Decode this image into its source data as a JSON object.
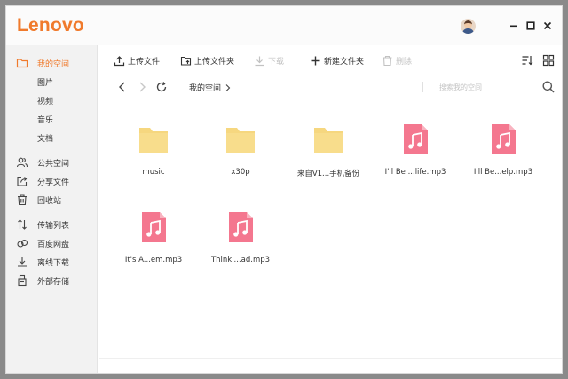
{
  "app": {
    "brand": "Lenovo",
    "accent_color": "#f07a2c"
  },
  "titlebar": {
    "avatar": "user-avatar",
    "minimize_icon": "minimize-icon",
    "maximize_icon": "maximize-icon",
    "close_icon": "close-icon"
  },
  "sidebar": {
    "my_space": {
      "label": "我的空间",
      "icon": "folder-icon"
    },
    "sub_items": [
      {
        "label": "图片"
      },
      {
        "label": "视频"
      },
      {
        "label": "音乐"
      },
      {
        "label": "文档"
      }
    ],
    "items": [
      {
        "label": "公共空间",
        "icon": "users-icon"
      },
      {
        "label": "分享文件",
        "icon": "share-icon"
      },
      {
        "label": "回收站",
        "icon": "trash-icon"
      },
      {
        "label": "传输列表",
        "icon": "transfer-icon"
      },
      {
        "label": "百度网盘",
        "icon": "cloud-icon"
      },
      {
        "label": "离线下载",
        "icon": "download-icon"
      },
      {
        "label": "外部存储",
        "icon": "usb-drive-icon"
      }
    ]
  },
  "toolbar": {
    "upload_file": "上传文件",
    "upload_folder": "上传文件夹",
    "download": "下载",
    "new_folder": "新建文件夹",
    "delete": "删除"
  },
  "pathbar": {
    "breadcrumb": "我的空间",
    "search_placeholder": "搜索我的空间"
  },
  "files": [
    {
      "name": "music",
      "type": "folder"
    },
    {
      "name": "x30p",
      "type": "folder"
    },
    {
      "name": "来自V1...手机备份",
      "type": "folder"
    },
    {
      "name": "I'll Be ...life.mp3",
      "type": "audio"
    },
    {
      "name": "I'll Be...elp.mp3",
      "type": "audio"
    },
    {
      "name": "It's A...em.mp3",
      "type": "audio"
    },
    {
      "name": "Thinki...ad.mp3",
      "type": "audio"
    }
  ],
  "colors": {
    "folder": "#f6d77f",
    "audio": "#f4778f",
    "active_bg": "#fdeee3"
  }
}
